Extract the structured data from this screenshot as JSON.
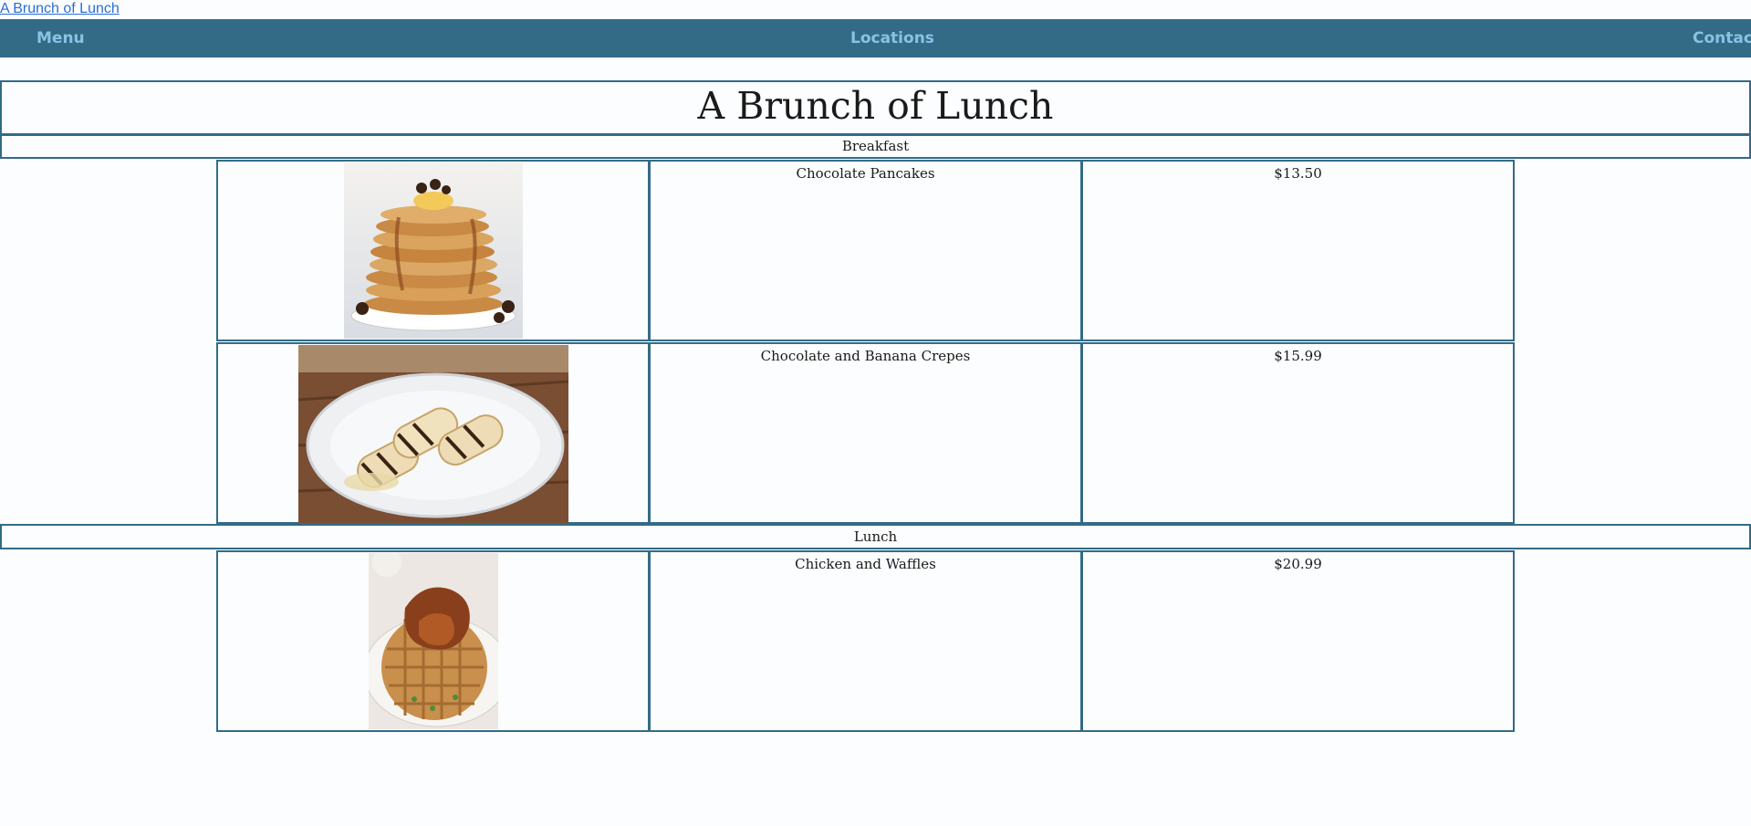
{
  "header": {
    "home_link": "A Brunch of Lunch",
    "nav": [
      "Menu",
      "Locations",
      "Contact"
    ]
  },
  "page_title": "A Brunch of Lunch",
  "sections": [
    {
      "name": "Breakfast",
      "items": [
        {
          "name": "Chocolate Pancakes",
          "price": "$13.50",
          "image": "pancakes-image"
        },
        {
          "name": "Chocolate and Banana Crepes",
          "price": "$15.99",
          "image": "crepes-image"
        }
      ]
    },
    {
      "name": "Lunch",
      "items": [
        {
          "name": "Chicken and Waffles",
          "price": "$20.99",
          "image": "chicken-waffles-image"
        }
      ]
    }
  ],
  "colors": {
    "accent": "#336b87",
    "nav_text": "#88c3e4",
    "link": "#2a6fd6",
    "background": "#fcfdfe"
  }
}
